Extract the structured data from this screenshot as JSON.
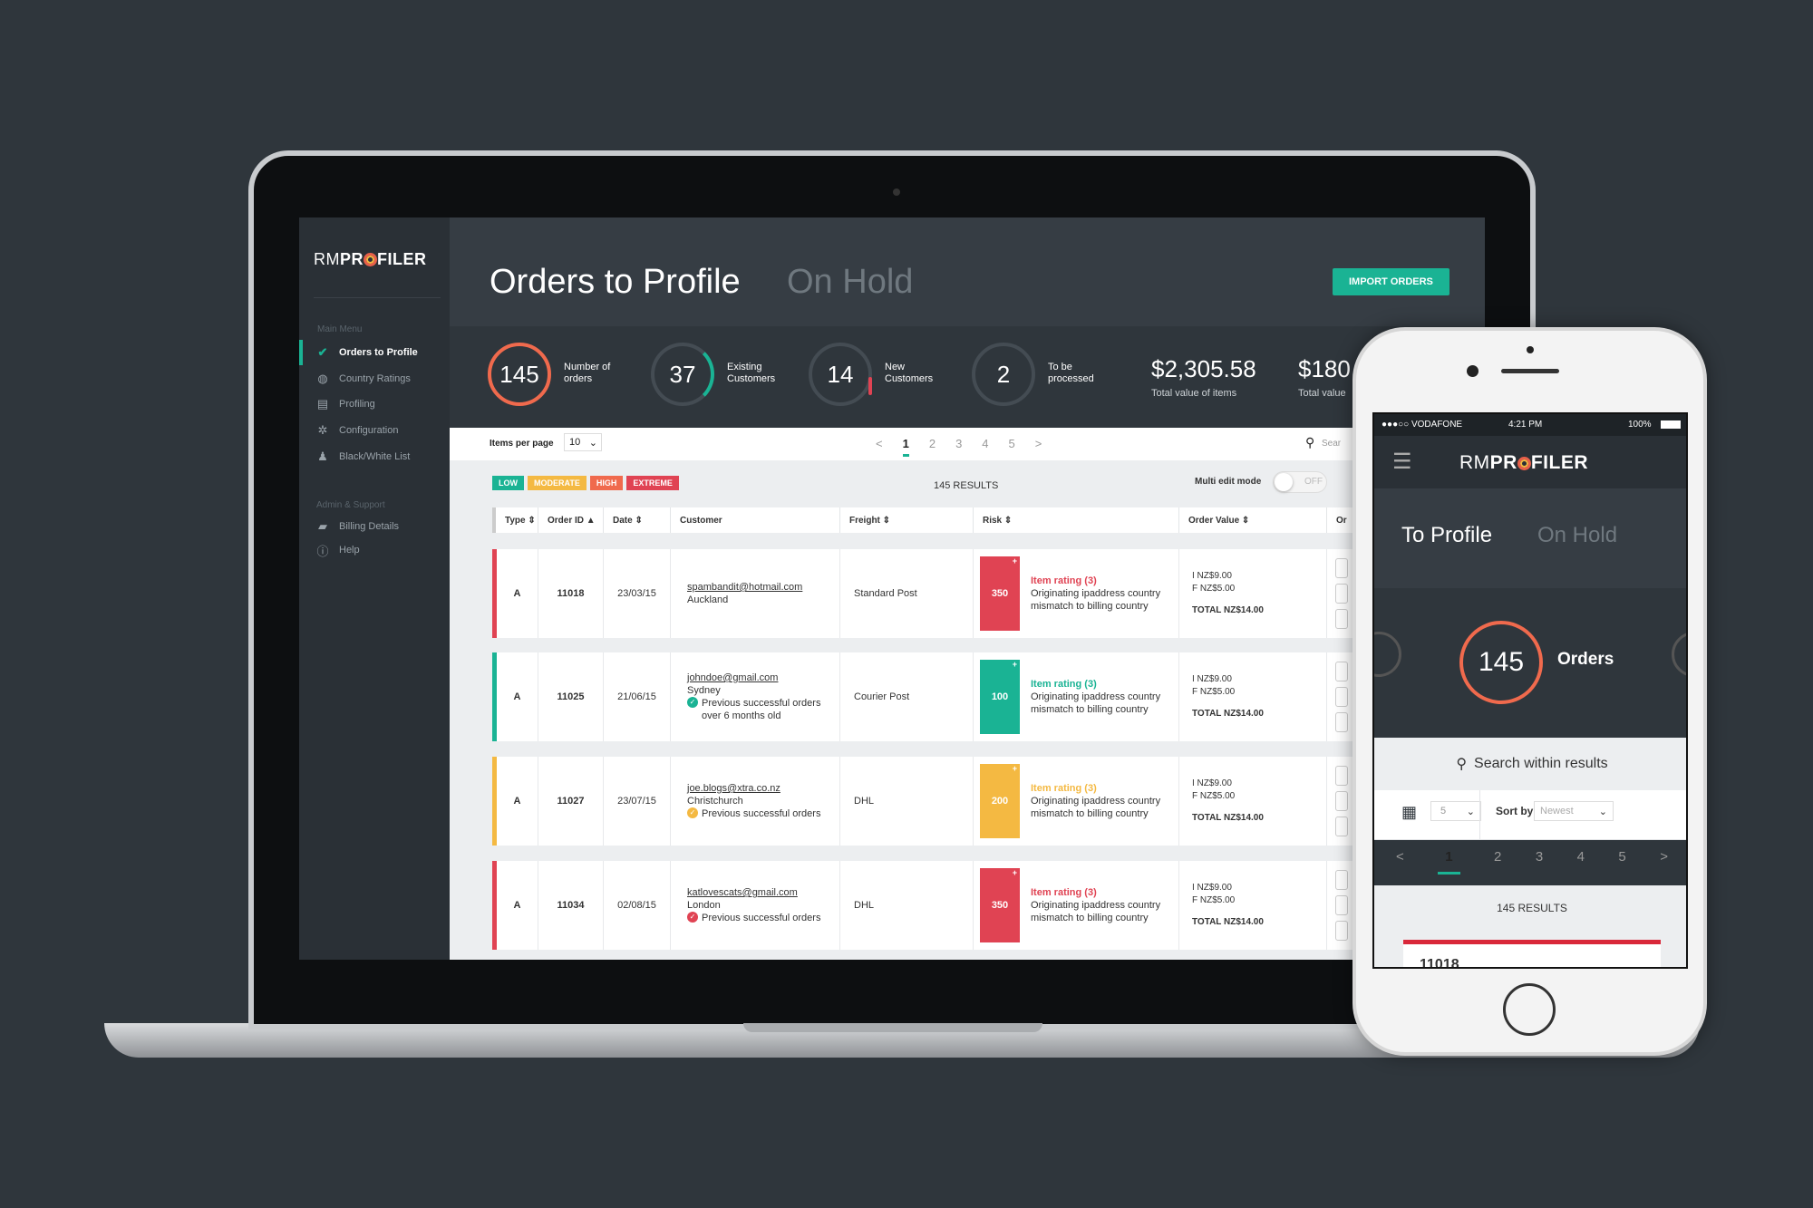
{
  "app": {
    "logo": "RMPROFILER"
  },
  "sidebar": {
    "main_heading": "Main Menu",
    "items": [
      {
        "label": "Orders to Profile",
        "icon": "check-circle-icon",
        "active": true
      },
      {
        "label": "Country Ratings",
        "icon": "globe-icon"
      },
      {
        "label": "Profiling",
        "icon": "clipboard-icon"
      },
      {
        "label": "Configuration",
        "icon": "gear-icon"
      },
      {
        "label": "Black/White List",
        "icon": "user-icon"
      }
    ],
    "admin_heading": "Admin & Support",
    "admin_items": [
      {
        "label": "Billing Details",
        "icon": "wallet-icon"
      },
      {
        "label": "Help",
        "icon": "help-icon"
      }
    ]
  },
  "header": {
    "tab_active": "Orders to Profile",
    "tab_inactive": "On Hold",
    "import_button": "IMPORT ORDERS"
  },
  "stats": [
    {
      "value": "145",
      "label1": "Number of",
      "label2": "orders",
      "color": "#f06a4d",
      "progress": 1
    },
    {
      "value": "37",
      "label1": "Existing",
      "label2": "Customers",
      "color": "#1ab394",
      "progress": 0.25
    },
    {
      "value": "14",
      "label1": "New",
      "label2": "Customers",
      "color": "#e04353",
      "progress": 0.1
    },
    {
      "value": "2",
      "label1": "To be",
      "label2": "processed",
      "color": "#444c53",
      "progress": 0
    }
  ],
  "money": [
    {
      "value": "$2,305.58",
      "label": "Total value of items"
    },
    {
      "value": "$180",
      "label": "Total value"
    }
  ],
  "toolbar": {
    "items_per_page_label": "Items per page",
    "items_per_page": "10",
    "pages": [
      "<",
      "1",
      "2",
      "3",
      "4",
      "5",
      ">"
    ],
    "current_page": "1",
    "search_placeholder": "Sear"
  },
  "legend": [
    {
      "label": "LOW",
      "color": "#1ab394"
    },
    {
      "label": "MODERATE",
      "color": "#f4b942"
    },
    {
      "label": "HIGH",
      "color": "#f06a4d"
    },
    {
      "label": "EXTREME",
      "color": "#e04353"
    }
  ],
  "results": "145 RESULTS",
  "multi_edit": {
    "label": "Multi edit mode",
    "state": "OFF"
  },
  "columns": [
    "Type ⇕",
    "Order ID ▲",
    "Date ⇕",
    "Customer",
    "Freight ⇕",
    "Risk ⇕",
    "Order Value ⇕",
    "Or"
  ],
  "rows": [
    {
      "type": "A",
      "id": "11018",
      "date": "23/03/15",
      "email": "spambandit@hotmail.com",
      "city": "Auckland",
      "note": "",
      "note2": "",
      "freight": "Standard Post",
      "score": "350",
      "rating": "Item rating (3)",
      "risk1": "Originating ipaddress country",
      "risk2": "mismatch to billing country",
      "i": "I NZ$9.00",
      "f": "F NZ$5.00",
      "total": "TOTAL NZ$14.00",
      "color": "#e04353"
    },
    {
      "type": "A",
      "id": "11025",
      "date": "21/06/15",
      "email": "johndoe@gmail.com",
      "city": "Sydney",
      "note": "Previous successful orders",
      "note2": "over 6 months old",
      "freight": "Courier Post",
      "score": "100",
      "rating": "Item rating (3)",
      "risk1": "Originating ipaddress country",
      "risk2": "mismatch to billing country",
      "i": "I NZ$9.00",
      "f": "F NZ$5.00",
      "total": "TOTAL NZ$14.00",
      "color": "#1ab394"
    },
    {
      "type": "A",
      "id": "11027",
      "date": "23/07/15",
      "email": "joe.blogs@xtra.co.nz",
      "city": "Christchurch",
      "note": "Previous successful orders",
      "note2": "",
      "freight": "DHL",
      "score": "200",
      "rating": "Item rating (3)",
      "risk1": "Originating ipaddress country",
      "risk2": "mismatch to billing country",
      "i": "I NZ$9.00",
      "f": "F NZ$5.00",
      "total": "TOTAL NZ$14.00",
      "color": "#f4b942"
    },
    {
      "type": "A",
      "id": "11034",
      "date": "02/08/15",
      "email": "katlovescats@gmail.com",
      "city": "London",
      "note": "Previous successful orders",
      "note2": "",
      "freight": "DHL",
      "score": "350",
      "rating": "Item rating (3)",
      "risk1": "Originating ipaddress country",
      "risk2": "mismatch to billing country",
      "i": "I NZ$9.00",
      "f": "F NZ$5.00",
      "total": "TOTAL NZ$14.00",
      "color": "#e04353"
    }
  ],
  "phone": {
    "carrier": "●●●○○ VODAFONE",
    "time": "4:21 PM",
    "battery": "100%",
    "tab_active": "To Profile",
    "tab_inactive": "On Hold",
    "orders_value": "145",
    "orders_label": "Orders",
    "search_placeholder": "Search within results",
    "per_page": "5",
    "sort_label": "Sort by",
    "sort_value": "Newest",
    "pages": [
      "<",
      "1",
      "2",
      "3",
      "4",
      "5",
      ">"
    ],
    "results": "145 RESULTS",
    "peek_id": "11018"
  }
}
